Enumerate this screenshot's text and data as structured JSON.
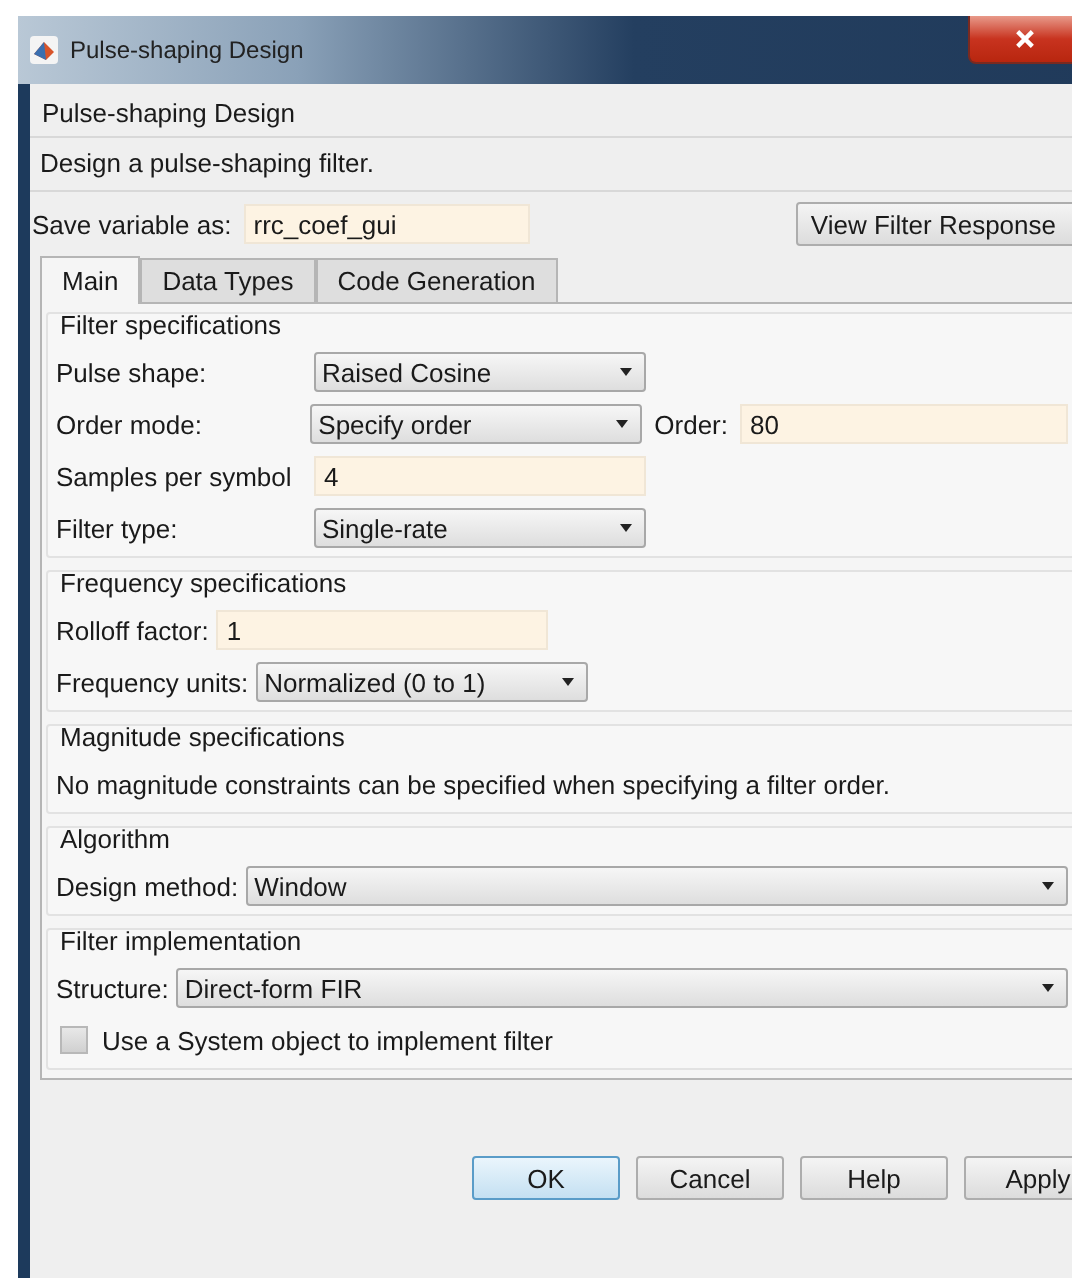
{
  "window": {
    "title": "Pulse-shaping Design"
  },
  "header": {
    "title": "Pulse-shaping Design",
    "description": "Design a pulse-shaping filter."
  },
  "save": {
    "label": "Save variable as:",
    "value": "rrc_coef_gui",
    "button": "View Filter Response"
  },
  "tabs": [
    {
      "label": "Main",
      "selected": true
    },
    {
      "label": "Data Types",
      "selected": false
    },
    {
      "label": "Code Generation",
      "selected": false
    }
  ],
  "sections": [
    {
      "title": "Filter specifications",
      "kind": "compact",
      "rows": [
        {
          "kind": "dropdown",
          "label": "Pulse shape:",
          "value": "Raised Cosine"
        },
        {
          "kind": "dropdown",
          "label": "Order mode:",
          "value": "Specify order",
          "extra": {
            "label": "Order:",
            "value": "80"
          }
        },
        {
          "kind": "field",
          "label": "Samples per symbol",
          "value": "4"
        },
        {
          "kind": "dropdown",
          "label": "Filter type:",
          "value": "Single-rate"
        }
      ]
    },
    {
      "title": "Frequency specifications",
      "kind": "compact",
      "rows": [
        {
          "kind": "field",
          "label": "Rolloff factor:",
          "value": "1"
        },
        {
          "kind": "dropdown",
          "label": "Frequency units:",
          "value": "Normalized (0 to 1)"
        }
      ]
    },
    {
      "title": "Magnitude specifications",
      "kind": "wide",
      "rows": [
        {
          "kind": "text",
          "label": "No magnitude constraints can be specified when specifying a filter order."
        }
      ]
    },
    {
      "title": "Algorithm",
      "kind": "wide",
      "rows": [
        {
          "kind": "dropdown",
          "label": "Design method:",
          "value": "Window"
        }
      ]
    },
    {
      "title": "Filter implementation",
      "kind": "wide",
      "rows": [
        {
          "kind": "dropdown",
          "label": "Structure:",
          "value": "Direct-form FIR"
        },
        {
          "kind": "checkbox",
          "label": "Use a System object to implement filter",
          "checked": false
        }
      ]
    }
  ],
  "buttons": [
    {
      "label": "OK",
      "default": true
    },
    {
      "label": "Cancel",
      "default": false
    },
    {
      "label": "Help",
      "default": false
    },
    {
      "label": "Apply",
      "default": false
    }
  ]
}
